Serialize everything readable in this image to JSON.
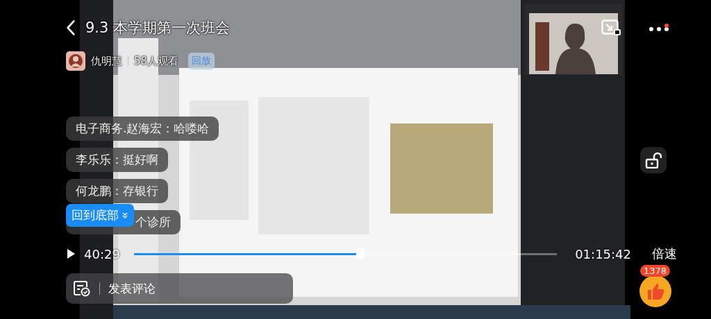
{
  "header": {
    "title": "9.3 本学期第一次班会",
    "host": "仇明慧",
    "viewers": "58人观看",
    "badge": "回放"
  },
  "comments": [
    {
      "text": "电子商务.赵海宏：哈喽哈"
    },
    {
      "text": "李乐乐：挺好啊"
    },
    {
      "text": "何龙鹏：存银行"
    },
    {
      "text": "个诊所"
    }
  ],
  "back_to_bottom": "回到底部",
  "lock": {
    "locked": false
  },
  "player": {
    "playing": false,
    "elapsed": "40:29",
    "level": 0.535,
    "duration": "01:15:42",
    "speed": "倍速"
  },
  "comment_bar": {
    "label": "发表评论"
  },
  "likes": {
    "count": "1378"
  }
}
